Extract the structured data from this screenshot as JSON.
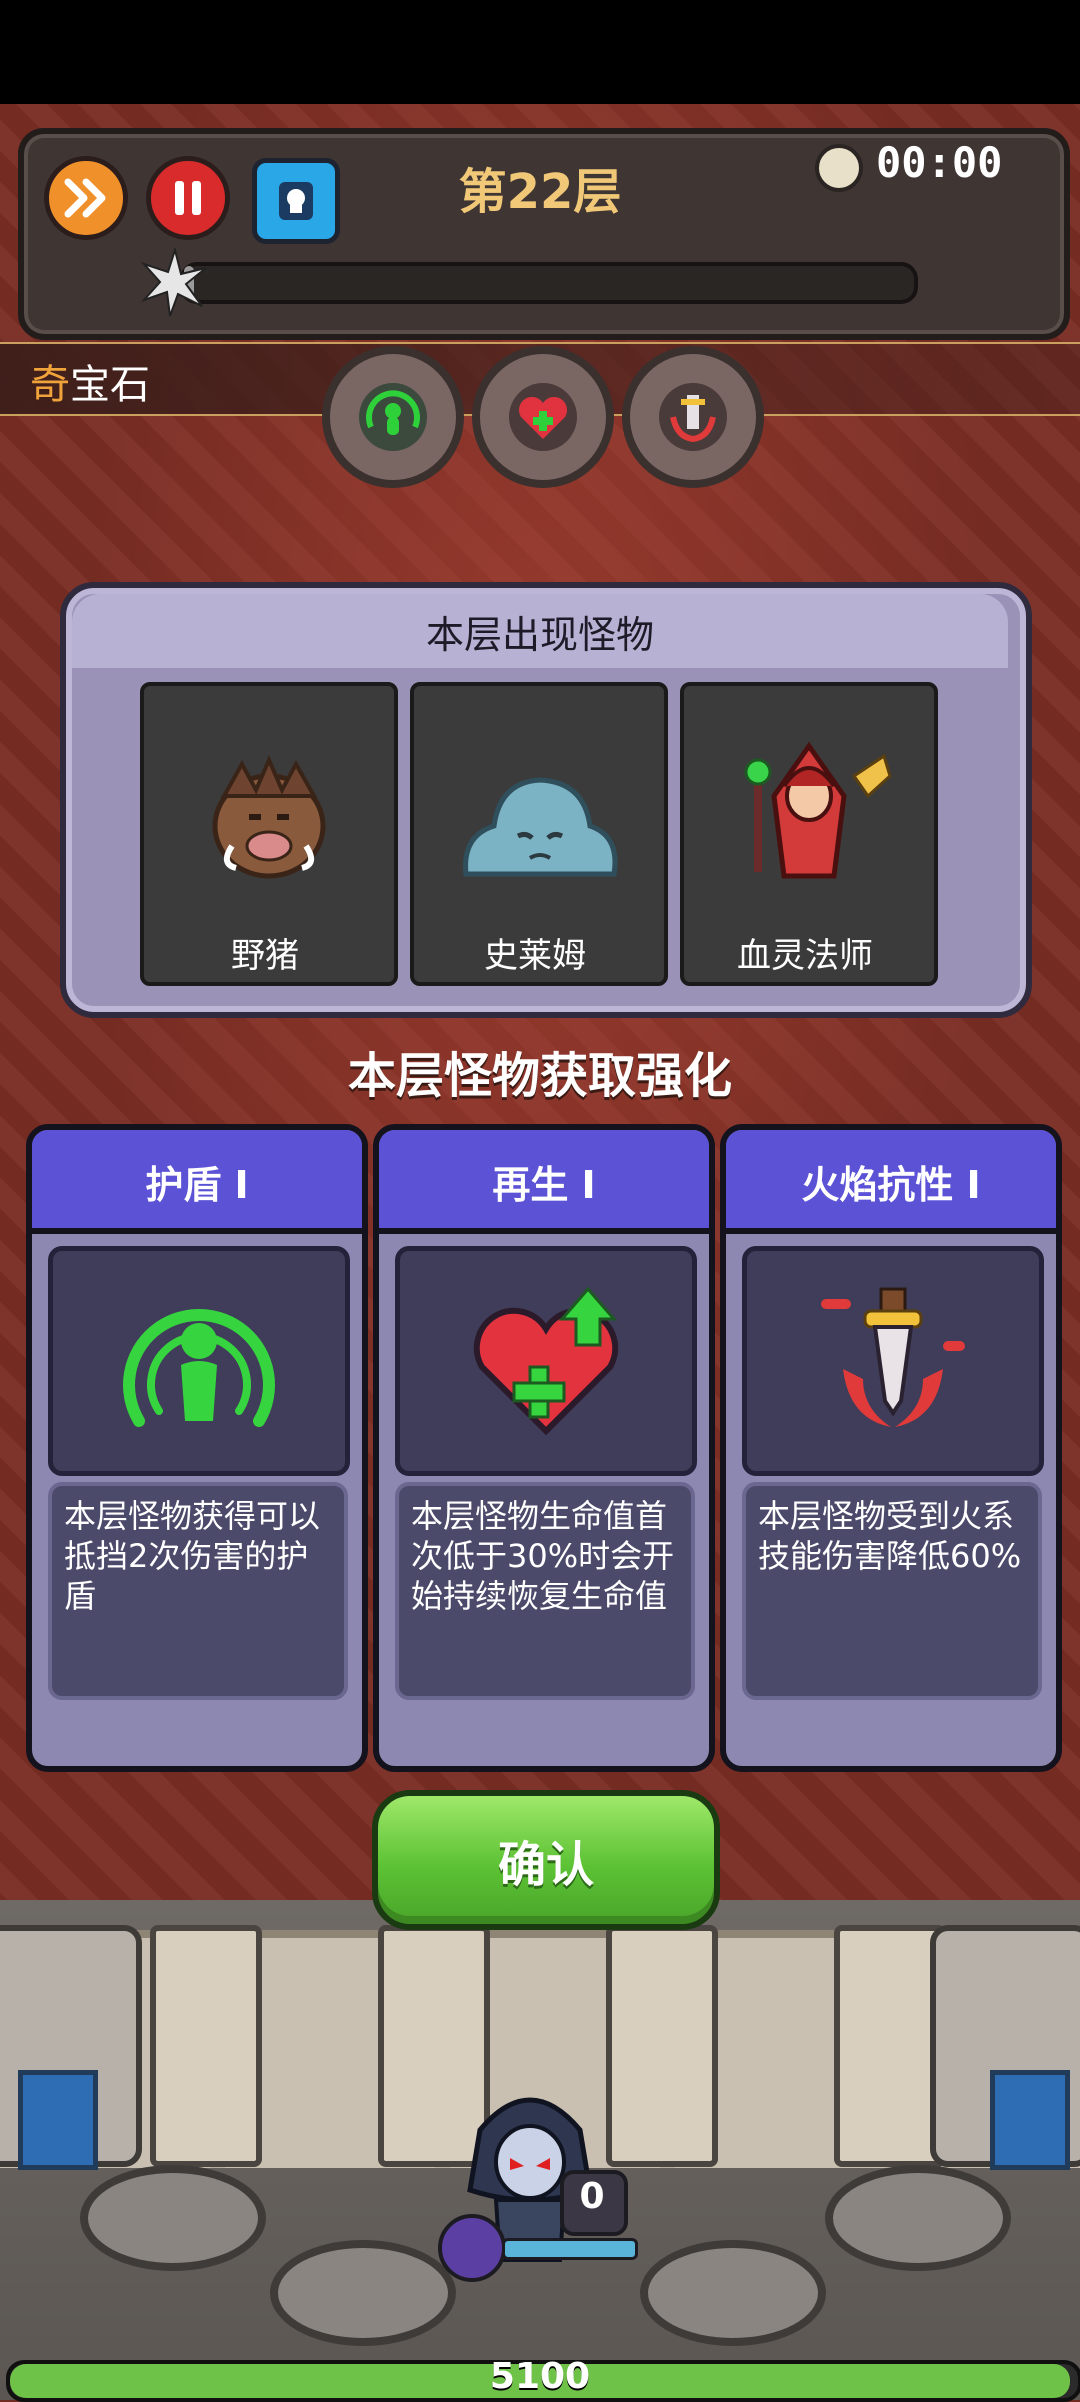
{
  "header": {
    "floor_title": "第22层",
    "timer": "00:00",
    "wave_progress": 0.0
  },
  "gem_bar": {
    "label_first": "奇",
    "label_rest": "宝石",
    "gems": [
      "shield-gem",
      "regen-gem",
      "fire-resist-gem"
    ]
  },
  "monster_panel": {
    "title": "本层出现怪物",
    "monsters": [
      {
        "name": "野猪",
        "icon": "boar-icon"
      },
      {
        "name": "史莱姆",
        "icon": "slime-icon"
      },
      {
        "name": "血灵法师",
        "icon": "blood-mage-icon"
      }
    ]
  },
  "buff_heading": "本层怪物获取强化",
  "buffs": [
    {
      "title": "护盾 I",
      "icon": "shield-aura-icon",
      "desc": "本层怪物获得可以抵挡2次伤害的护盾"
    },
    {
      "title": "再生 I",
      "icon": "heart-regen-icon",
      "desc": "本层怪物生命值首次低于30%时会开始持续恢复生命值"
    },
    {
      "title": "火焰抗性 I",
      "icon": "fire-resist-icon",
      "desc": "本层怪物受到火系技能伤害降低60%"
    }
  ],
  "confirm_label": "确认",
  "hero": {
    "count": "0"
  },
  "base_hp": "5100",
  "colors": {
    "accent": "#5b52d6",
    "confirm": "#5cc234",
    "floor_title": "#f1c878",
    "gem_first": "#f0a23b"
  }
}
